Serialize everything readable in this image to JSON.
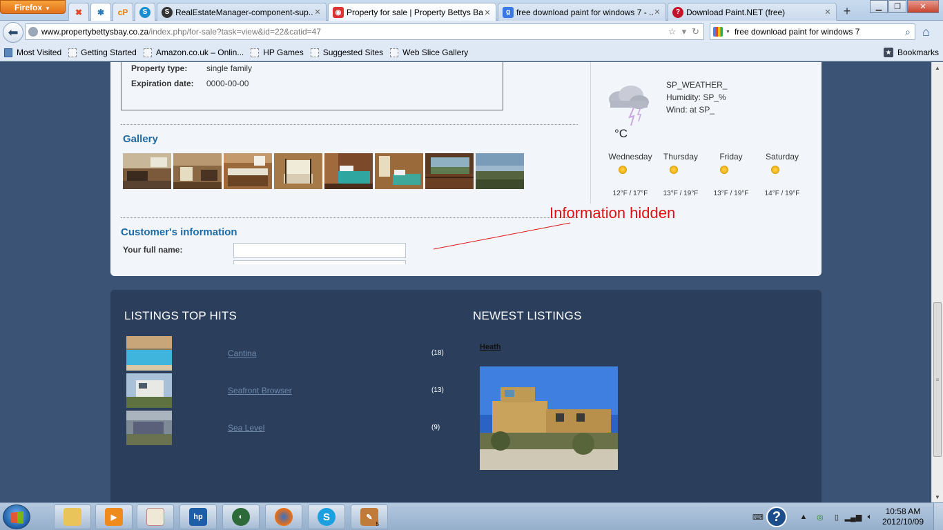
{
  "browser": {
    "firefox_button": "Firefox",
    "tabs": [
      {
        "title": "RealEstateManager-component-sup...",
        "icon": "wordpress-icon"
      },
      {
        "title": "Property for sale | Property Bettys Ba...",
        "icon": "site-icon"
      },
      {
        "title": "free download paint for windows 7 - ...",
        "icon": "google-icon"
      },
      {
        "title": "Download Paint.NET (free)",
        "icon": "download-icon"
      }
    ],
    "app_tabs": [
      "joomla-icon",
      "joomla-icon",
      "cpanel-icon",
      "skype-icon"
    ],
    "app_tab_labels": {
      "cpanel": "cP"
    },
    "url_domain": "www.propertybettysbay.co.za",
    "url_path": "/index.php/for-sale?task=view&id=22&catid=47",
    "search_query": "free download paint for windows 7",
    "bookmarks": [
      "Most Visited",
      "Getting Started",
      "Amazon.co.uk – Onlin...",
      "HP Games",
      "Suggested Sites",
      "Web Slice Gallery"
    ],
    "bookmarks_menu": "Bookmarks"
  },
  "property": {
    "details": [
      {
        "label": "Property type:",
        "value": "single family"
      },
      {
        "label": "Expiration date:",
        "value": "0000-00-00"
      }
    ],
    "gallery_heading": "Gallery",
    "customer_heading": "Customer's information",
    "fullname_label": "Your full name:",
    "fullname_value": ""
  },
  "weather": {
    "condition": "SP_WEATHER_",
    "humidity": "Humidity: SP_%",
    "wind": "Wind: at SP_",
    "unit": "°C",
    "forecast": [
      {
        "day": "Wednesday",
        "temps": "12°F / 17°F"
      },
      {
        "day": "Thursday",
        "temps": "13°F / 19°F"
      },
      {
        "day": "Friday",
        "temps": "13°F / 19°F"
      },
      {
        "day": "Saturday",
        "temps": "14°F / 19°F"
      }
    ]
  },
  "annotation": "Information hidden",
  "listings": {
    "top_hits_title": "LISTINGS TOP HITS",
    "newest_title": "NEWEST LISTINGS",
    "top_hits": [
      {
        "name": "Cantina",
        "count": "(18)"
      },
      {
        "name": "Seafront Browser",
        "count": "(13)"
      },
      {
        "name": "Sea Level",
        "count": "(9)"
      }
    ],
    "newest": {
      "name": "Heath"
    }
  },
  "taskbar": {
    "pinned": [
      "explorer-icon",
      "media-player-icon",
      "paint-icon",
      "hp-icon",
      "media-center-icon",
      "firefox-icon",
      "skype-icon",
      "paint-net-icon"
    ],
    "hp_label": "hp",
    "paint_net_badge": "5",
    "clock_time": "10:58 AM",
    "clock_date": "2012/10/09"
  },
  "colors": {
    "page_bg": "#3b5475",
    "panel_bg": "#f2f6fb",
    "heading_blue": "#1d6aa5",
    "lower_panel": "#2b3e5c",
    "annotation_red": "#e01010"
  }
}
